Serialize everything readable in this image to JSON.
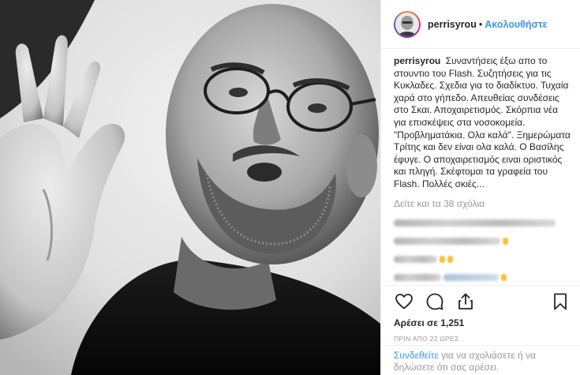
{
  "header": {
    "username": "perrisyrou",
    "separator": "•",
    "follow_label": "Ακολουθήστε"
  },
  "caption": {
    "username": "perrisyrou",
    "text": "Συναντήσεις έξω απο το στουντιο του Flash. Συζητήσεις για τις Κυκλαδες. Σχεδια για το διαδίκτυο. Τυχαία χαρά στο γήπεδο. Απευθείας συνδέσεις στο Σκαι. Αποχαιρετισμός. Σκόρπια νέα για επισκέψεις στα νοσοκομεία. \"Προβληματάκια. Ολα καλά\". Ξημερώματα Τρίτης και δεν είναι ολα καλά. Ο Βασίλης έφυγε. Ο αποχαιρετισμός ειναι οριστικός και πληγή. Σκέφτομαι τα γραφεία του Flash. Πολλές σκιές..."
  },
  "view_all_comments": "Δείτε και τα 38 σχόλια",
  "likes": "Αρέσει σε 1,251",
  "timestamp": "ΠΡΙΝ ΑΠΟ 22 ΩΡΕΣ",
  "login_prompt": {
    "link": "Συνδεθείτε",
    "text": " για να σχολιάσετε ή να δηλώσετε ότι σας αρέσει."
  },
  "icons": {
    "like": "heart-icon",
    "comment": "comment-icon",
    "share": "share-icon",
    "save": "bookmark-icon"
  },
  "colors": {
    "accent": "#3897f0",
    "text": "#262626",
    "muted": "#999999",
    "border": "#efefef"
  }
}
